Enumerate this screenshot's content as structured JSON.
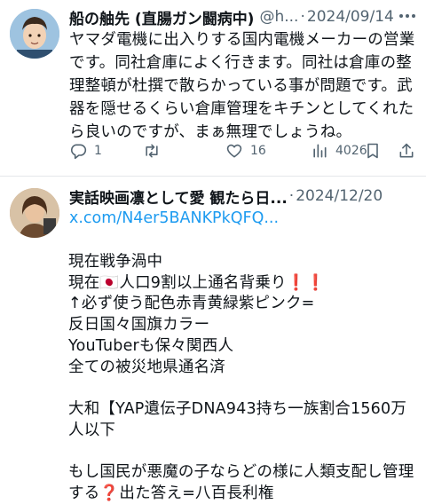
{
  "tweets": [
    {
      "author_name": "船の舳先 (直腸ガン闘病中)",
      "handle": "@h...",
      "separator": "·",
      "date": "2024/09/14",
      "text": "ヤマダ電機に出入りする国内電機メーカーの営業です。同社倉庫によく行きます。同社は倉庫の整理整頓が杜撰で散らかっている事が問題です。武器を隠せるくらい倉庫管理をキチンとしてくれたら良いのですが、まぁ無理でしょうね。",
      "actions": {
        "replies": "1",
        "retweets": "",
        "likes": "16",
        "views": "4026"
      },
      "icons": {
        "reply": "reply-icon",
        "retweet": "retweet-icon",
        "like": "heart-icon",
        "views": "views-chart-icon",
        "bookmark": "bookmark-icon",
        "share": "share-icon",
        "more": "more-dots-icon"
      }
    },
    {
      "author_name": "実話映画凛として愛 観たら日...",
      "separator": "·",
      "date": "2024/12/20",
      "link": "x.com/N4er5BANKPkQFQ...",
      "text": "現在戦争渦中\n現在🇯🇵人口9割以上通名背乗り❗❗\n↑必ず使う配色赤青黄緑紫ピンク=\n反日国々国旗カラー\nYouTuberも保々関西人\n全ての被災地県通名済\n\n大和【YAP遺伝子DNA943持ち一族割合1560万人以下\n\nもし国民が悪魔の子ならどの様に人類支配し管理する❓出た答え=八百長利権"
    }
  ],
  "colors": {
    "text": "#0f1419",
    "secondary": "#536471",
    "link": "#1d9bf0",
    "divider": "#e4e7ea"
  }
}
